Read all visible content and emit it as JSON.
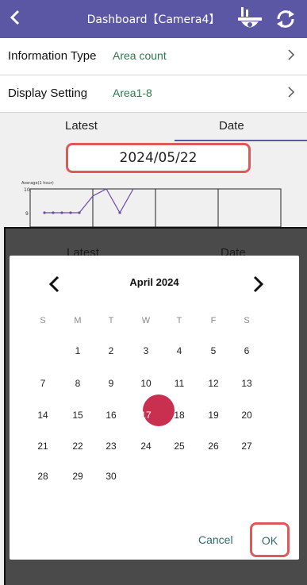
{
  "header": {
    "title": "Dashboard【Camera4】",
    "back_icon": "chevron-left-icon",
    "camera_icon": "camera-network-icon",
    "refresh_icon": "refresh-icon",
    "bg_color": "#5b57a4"
  },
  "settings": {
    "info_label": "Information Type",
    "info_value": "Area count",
    "display_label": "Display Setting",
    "display_value": "Area1-8",
    "value_color": "#2b7a4b"
  },
  "tabs": {
    "latest": "Latest",
    "date": "Date"
  },
  "selected_date": "2024/05/22",
  "chart": {
    "ylabel": "Average(1 hour)",
    "ytick_top": "10",
    "ytick_mid": "9"
  },
  "chart_data": {
    "type": "line",
    "ylabel": "Average(1 hour)",
    "y_ticks": [
      "10",
      "9"
    ],
    "series": [
      {
        "values": [
          9,
          9,
          9,
          9,
          9,
          9.7,
          10,
          9,
          10
        ]
      }
    ]
  },
  "calendar": {
    "month_label": "April 2024",
    "prev_icon": "chevron-left-icon",
    "next_icon": "chevron-right-icon",
    "weekdays": [
      "S",
      "M",
      "T",
      "W",
      "T",
      "F",
      "S"
    ],
    "weeks": [
      [
        "",
        "1",
        "2",
        "3",
        "4",
        "5",
        "6"
      ],
      [
        "7",
        "8",
        "9",
        "10",
        "11",
        "12",
        "13"
      ],
      [
        "14",
        "15",
        "16",
        "17",
        "18",
        "19",
        "20"
      ],
      [
        "21",
        "22",
        "23",
        "24",
        "25",
        "26",
        "27"
      ],
      [
        "28",
        "29",
        "30",
        "",
        "",
        "",
        ""
      ]
    ],
    "selected_day": "17",
    "selected_color": "#c9304f",
    "cancel_label": "Cancel",
    "ok_label": "OK",
    "highlight_color": "#e0595a"
  }
}
